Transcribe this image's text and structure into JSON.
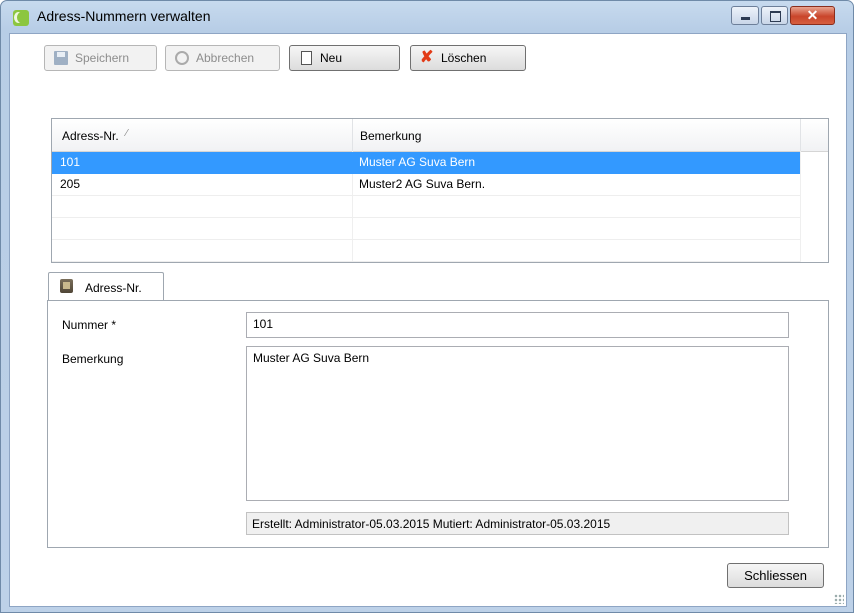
{
  "window": {
    "title": "Adress-Nummern verwalten",
    "accent": "#3399ff",
    "close_glyph": "✕"
  },
  "toolbar": {
    "save_label": "Speichern",
    "cancel_label": "Abbrechen",
    "new_label": "Neu",
    "delete_label": "Löschen",
    "delete_glyph": "✘"
  },
  "grid": {
    "columns": [
      "Adress-Nr.",
      "Bemerkung"
    ],
    "sort_indicator": "⁄",
    "rows": [
      {
        "nr": "101",
        "bemerkung": "Muster AG Suva Bern",
        "selected": true
      },
      {
        "nr": "205",
        "bemerkung": "Muster2 AG Suva Bern.",
        "selected": false
      }
    ]
  },
  "detail": {
    "tab_label": "Adress-Nr.",
    "nummer_label": "Nummer *",
    "nummer_value": "101",
    "bemerkung_label": "Bemerkung",
    "bemerkung_value": "Muster AG Suva Bern",
    "info": "Erstellt: Administrator-05.03.2015  Mutiert: Administrator-05.03.2015"
  },
  "footer": {
    "close_label": "Schliessen"
  }
}
